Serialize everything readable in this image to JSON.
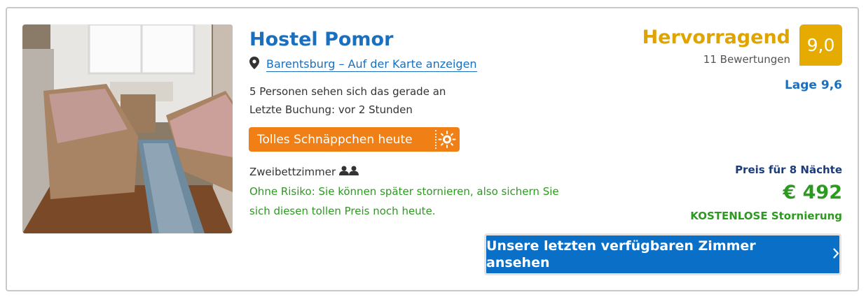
{
  "hotel": {
    "name": "Hostel Pomor",
    "location_link": "Barentsburg – Auf der Karte anzeigen",
    "viewers_text": "5 Personen sehen sich das gerade an",
    "last_booking": "Letzte Buchung: vor 2 Stunden",
    "deal_badge": "Tolles Schnäppchen heute",
    "room_type": "Zweibettzimmer",
    "no_risk_text": "Ohne Risiko: Sie können später stornieren, also sichern Sie sich diesen tollen Preis noch heute."
  },
  "rating": {
    "label": "Hervorragend",
    "reviews": "11 Bewertungen",
    "score": "9,0",
    "location_score": "Lage 9,6"
  },
  "pricing": {
    "nights_label": "Preis für 8 Nächte",
    "price": "€ 492",
    "cancellation": "KOSTENLOSE Stornierung"
  },
  "cta": {
    "label": "Unsere letzten verfügbaren Zimmer ansehen"
  },
  "icons": {
    "location": "map-pin-icon",
    "people": "two-persons-icon",
    "deal": "sun-badge-icon",
    "chevron": "chevron-right-icon"
  },
  "colors": {
    "brand_blue": "#1a6fbf",
    "cta_blue": "#0a6fc7",
    "deal_orange": "#f07f16",
    "rating_gold": "#e6ab00",
    "success_green": "#2c9a1f"
  }
}
